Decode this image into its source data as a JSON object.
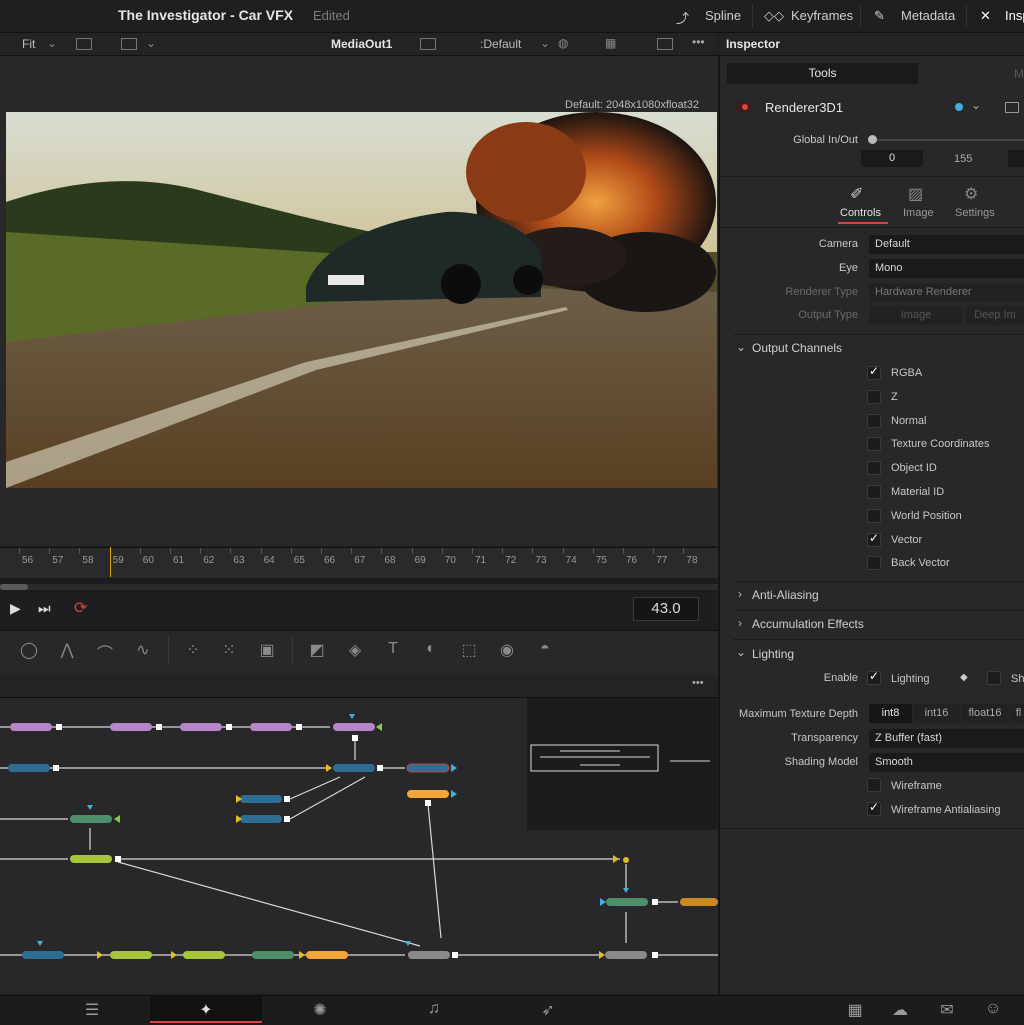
{
  "topbar": {
    "title": "The Investigator - Car VFX",
    "status": "Edited",
    "spline": "Spline",
    "keyframes": "Keyframes",
    "metadata": "Metadata",
    "inspector_tab": "Insp"
  },
  "viewer_bar": {
    "fit": "Fit",
    "node": "MediaOut1",
    "lut": ":Default"
  },
  "viewer": {
    "resolution": "Default: 2048x1080xfloat32"
  },
  "timeline": {
    "ticks": [
      "56",
      "57",
      "58",
      "59",
      "60",
      "61",
      "62",
      "63",
      "64",
      "65",
      "66",
      "67",
      "68",
      "69",
      "70",
      "71",
      "72",
      "73",
      "74",
      "75",
      "76",
      "77",
      "78"
    ]
  },
  "transport": {
    "frame": "43.0"
  },
  "inspector": {
    "header": "Inspector",
    "tab_tools": "Tools",
    "tab_modifiers": "Modifi",
    "node_name": "Renderer3D1",
    "global_label": "Global In/Out",
    "global_in": "0",
    "global_mid": "155",
    "sub_tabs": {
      "controls": "Controls",
      "image": "Image",
      "settings": "Settings"
    },
    "camera_label": "Camera",
    "camera_value": "Default",
    "eye_label": "Eye",
    "eye_value": "Mono",
    "renderer_type_label": "Renderer Type",
    "renderer_type_value": "Hardware Renderer",
    "output_type_label": "Output Type",
    "output_type_image": "Image",
    "output_type_deep": "Deep Im",
    "output_channels": "Output Channels",
    "channels": [
      {
        "label": "RGBA",
        "checked": true
      },
      {
        "label": "Z",
        "checked": false
      },
      {
        "label": "Normal",
        "checked": false
      },
      {
        "label": "Texture Coordinates",
        "checked": false
      },
      {
        "label": "Object ID",
        "checked": false
      },
      {
        "label": "Material ID",
        "checked": false
      },
      {
        "label": "World Position",
        "checked": false
      },
      {
        "label": "Vector",
        "checked": true
      },
      {
        "label": "Back Vector",
        "checked": false
      }
    ],
    "anti_aliasing": "Anti-Aliasing",
    "accumulation": "Accumulation Effects",
    "lighting": "Lighting",
    "enable_label": "Enable",
    "lighting_check": "Lighting",
    "shadows_check": "Sh",
    "max_tex_label": "Maximum Texture Depth",
    "tex_opts": [
      "int8",
      "int16",
      "float16",
      "fl"
    ],
    "transparency_label": "Transparency",
    "transparency_value": "Z Buffer (fast)",
    "shading_label": "Shading Model",
    "shading_value": "Smooth",
    "wireframe": "Wireframe",
    "wireframe_aa": "Wireframe Antialiasing"
  },
  "colors": {
    "accent": "#e0a400",
    "node_purple": "#b784c8",
    "node_blue": "#2f6e94",
    "node_green": "#4c8f6a",
    "node_lime": "#a6c53a",
    "node_orange": "#f2a53a",
    "node_gray": "#8a8a8a"
  }
}
